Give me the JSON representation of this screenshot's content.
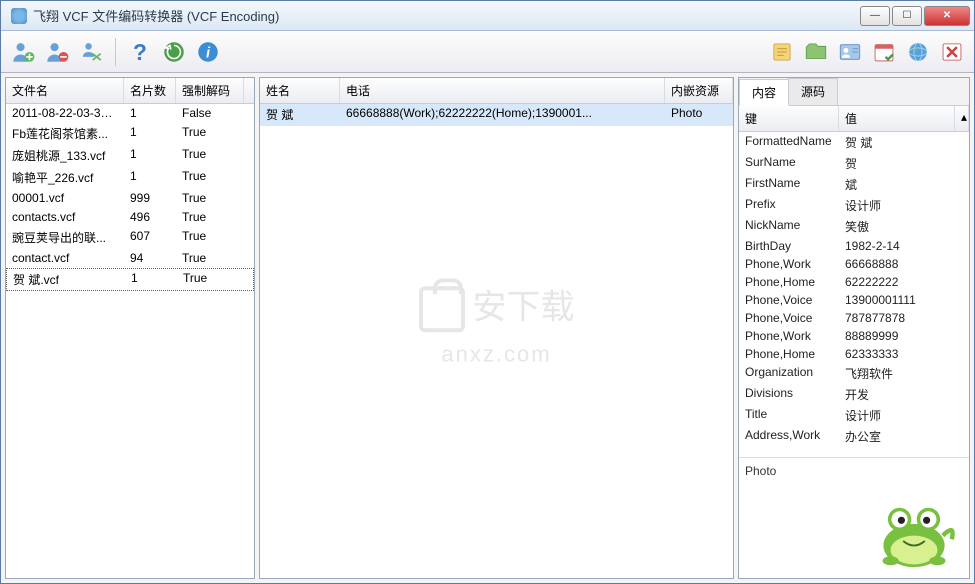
{
  "window": {
    "title": "飞翔 VCF 文件编码转换器 (VCF Encoding)"
  },
  "toolbar_icons": {
    "add_user": "add-user-icon",
    "remove_user": "remove-user-icon",
    "swap_user": "swap-user-icon",
    "help": "help-icon",
    "refresh": "refresh-icon",
    "info": "info-icon",
    "notes": "notes-icon",
    "folder": "folder-icon",
    "contact_card": "contact-card-icon",
    "calendar": "calendar-icon",
    "globe": "globe-icon",
    "delete": "delete-icon"
  },
  "left_panel": {
    "headers": [
      "文件名",
      "名片数",
      "强制解码"
    ],
    "rows": [
      {
        "name": "2011-08-22-03-31-...",
        "count": "1",
        "decode": "False"
      },
      {
        "name": "Fb莲花阁茶馆素...",
        "count": "1",
        "decode": "True"
      },
      {
        "name": "庞姐桃源_133.vcf",
        "count": "1",
        "decode": "True"
      },
      {
        "name": "喻艳平_226.vcf",
        "count": "1",
        "decode": "True"
      },
      {
        "name": "00001.vcf",
        "count": "999",
        "decode": "True"
      },
      {
        "name": "contacts.vcf",
        "count": "496",
        "decode": "True"
      },
      {
        "name": "豌豆荚导出的联...",
        "count": "607",
        "decode": "True"
      },
      {
        "name": "contact.vcf",
        "count": "94",
        "decode": "True"
      },
      {
        "name": "贺 斌.vcf",
        "count": "1",
        "decode": "True"
      }
    ],
    "selected_index": 8
  },
  "middle_panel": {
    "headers": [
      "姓名",
      "电话",
      "内嵌资源"
    ],
    "rows": [
      {
        "name": "贺 斌",
        "phone": "66668888(Work);62222222(Home);1390001...",
        "res": "Photo"
      }
    ],
    "selected_index": 0
  },
  "right_panel": {
    "tabs": [
      "内容",
      "源码"
    ],
    "active_tab": 0,
    "detail_headers": [
      "键",
      "值"
    ],
    "details": [
      {
        "k": "FormattedName",
        "v": "贺 斌"
      },
      {
        "k": "SurName",
        "v": "贺"
      },
      {
        "k": "FirstName",
        "v": "斌"
      },
      {
        "k": "Prefix",
        "v": "设计师"
      },
      {
        "k": "NickName",
        "v": "笑傲"
      },
      {
        "k": "BirthDay",
        "v": "1982-2-14"
      },
      {
        "k": "Phone,Work",
        "v": "66668888"
      },
      {
        "k": "Phone,Home",
        "v": "62222222"
      },
      {
        "k": "Phone,Voice",
        "v": "13900001111"
      },
      {
        "k": "Phone,Voice",
        "v": "787877878"
      },
      {
        "k": "Phone,Work",
        "v": "88889999"
      },
      {
        "k": "Phone,Home",
        "v": "62333333"
      },
      {
        "k": "Organization",
        "v": "飞翔软件"
      },
      {
        "k": "Divisions",
        "v": "开发"
      },
      {
        "k": "Title",
        "v": "设计师"
      },
      {
        "k": "Address,Work",
        "v": "办公室"
      }
    ],
    "photo_label": "Photo"
  },
  "watermark": {
    "main": "安下载",
    "sub": "anxz.com"
  }
}
